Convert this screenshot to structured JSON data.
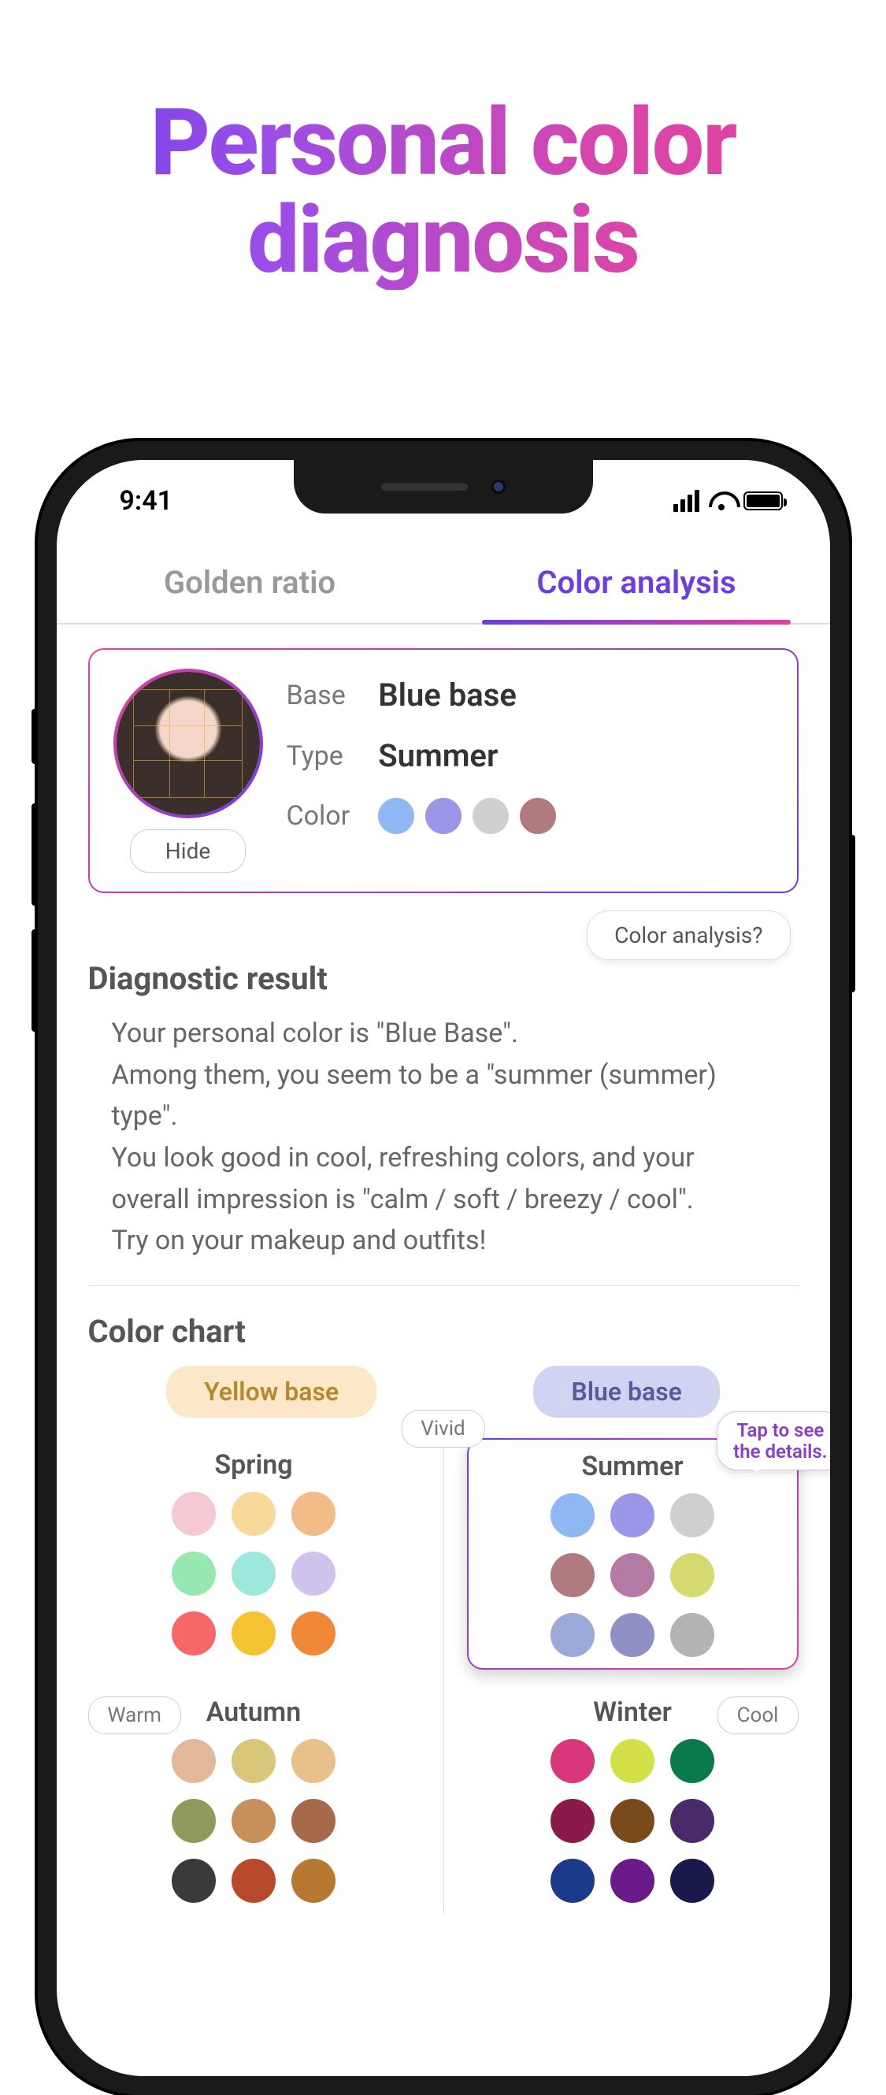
{
  "promo": {
    "line1": "Personal color",
    "line2": "diagnosis"
  },
  "status": {
    "time": "9:41"
  },
  "tabs": {
    "left": "Golden ratio",
    "right": "Color analysis"
  },
  "card": {
    "base_label": "Base",
    "base_value": "Blue base",
    "type_label": "Type",
    "type_value": "Summer",
    "color_label": "Color",
    "swatches": [
      "#8fb7f2",
      "#9a96e8",
      "#cfcfcf",
      "#b07a7e"
    ],
    "hide": "Hide"
  },
  "help_pill": "Color analysis?",
  "diag": {
    "title": "Diagnostic result",
    "body": "Your personal color is \"Blue Base\".\nAmong them, you seem to be a \"summer (summer) type\".\nYou look good in cool, refreshing colors, and your overall impression is \"calm / soft / breezy / cool\".\nTry on your makeup and outfits!"
  },
  "chart": {
    "title": "Color chart",
    "yellow_base": "Yellow base",
    "blue_base": "Blue base",
    "vivid": "Vivid",
    "warm": "Warm",
    "cool": "Cool",
    "tooltip": "Tap to see the details.",
    "seasons": {
      "spring": {
        "name": "Spring",
        "colors": [
          "#f5c9d3",
          "#f7da9a",
          "#f2bb88",
          "#96e8b0",
          "#9de8dc",
          "#cfc2ed",
          "#f56865",
          "#f5c332",
          "#f08838"
        ]
      },
      "summer": {
        "name": "Summer",
        "colors": [
          "#8fb7f2",
          "#9a96e8",
          "#cfcfcf",
          "#b07a7e",
          "#b47aa6",
          "#d4da70",
          "#9aa9d8",
          "#8f90c4",
          "#b3b3b3"
        ]
      },
      "autumn": {
        "name": "Autumn",
        "colors": [
          "#e3b89a",
          "#d8c778",
          "#e8c089",
          "#8f9a5a",
          "#c78f5a",
          "#a66a4a",
          "#3a3a3a",
          "#b8482a",
          "#b87832"
        ]
      },
      "winter": {
        "name": "Winter",
        "colors": [
          "#d8387a",
          "#d4e048",
          "#0a7a4a",
          "#8a1a4a",
          "#7a4a1a",
          "#4a2a6a",
          "#1a3a8a",
          "#6a1a8a",
          "#1a1a4a"
        ]
      }
    }
  }
}
